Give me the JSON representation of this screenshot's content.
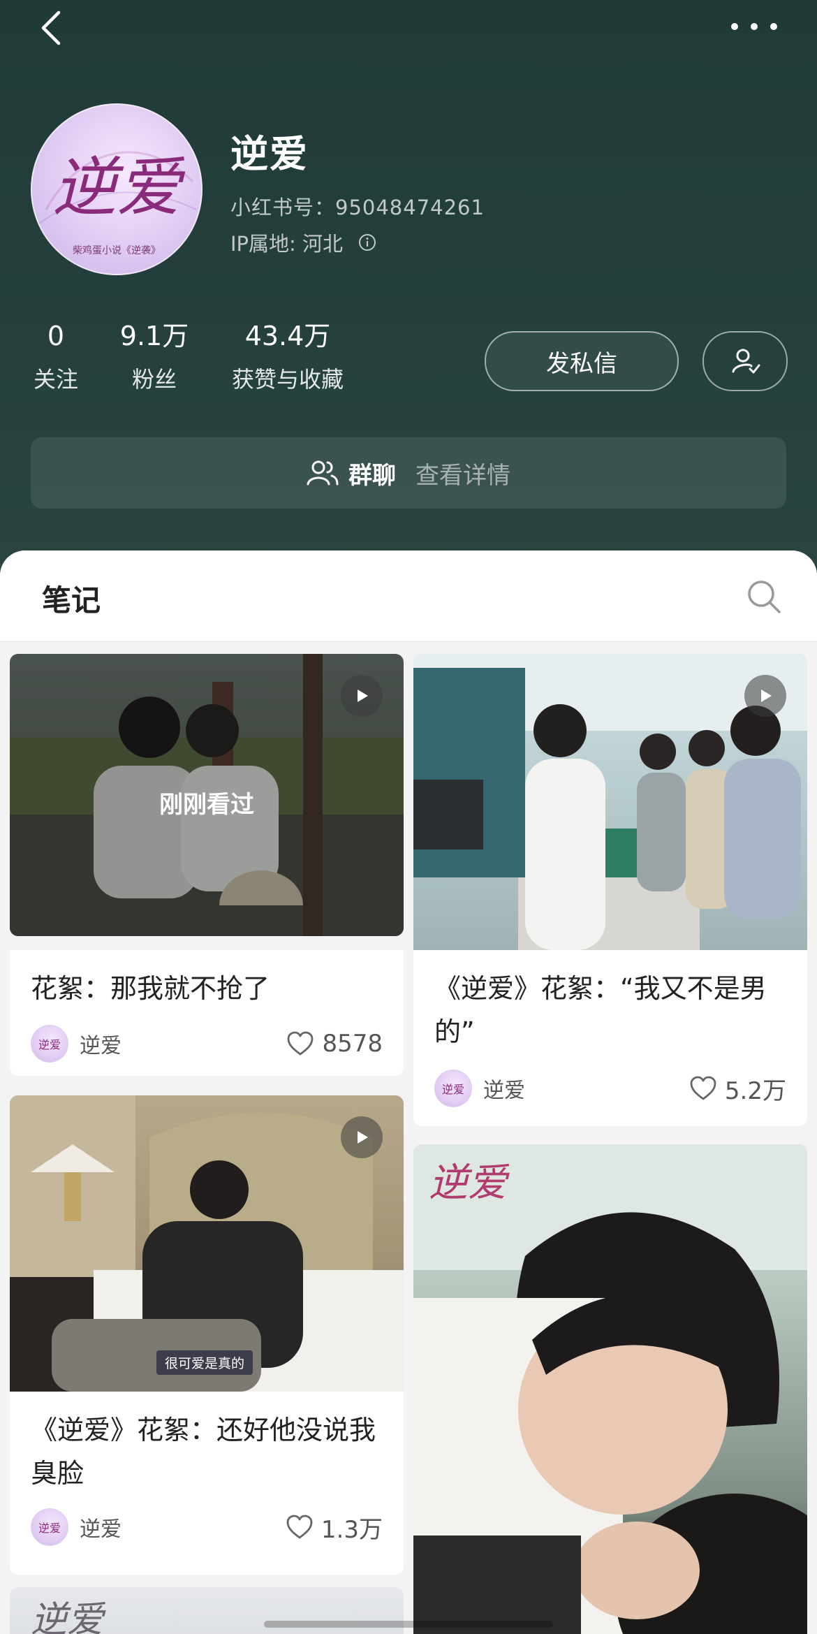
{
  "profile": {
    "name": "逆爱",
    "id_text": "小红书号：95048474261",
    "ip_text": "IP属地: 河北",
    "avatar_text": "逆爱",
    "avatar_caption": "柴鸡蛋小说《逆袭》"
  },
  "stats": [
    {
      "value": "0",
      "label": "关注"
    },
    {
      "value": "9.1万",
      "label": "粉丝"
    },
    {
      "value": "43.4万",
      "label": "获赞与收藏"
    }
  ],
  "actions": {
    "message_label": "发私信"
  },
  "group": {
    "title": "群聊",
    "detail": "查看详情"
  },
  "tabs": {
    "notes": "笔记"
  },
  "notes": [
    {
      "title": "花絮：那我就不抢了",
      "author": "逆爱",
      "likes": "8578",
      "overlay": "刚刚看过",
      "video": true
    },
    {
      "title": "《逆爱》花絮：“我又不是男的”",
      "author": "逆爱",
      "likes": "5.2万",
      "video": true
    },
    {
      "title": "《逆爱》花絮：还好他没说我臭脸",
      "author": "逆爱",
      "likes": "1.3万",
      "video": true,
      "subtitle": "很可爱是真的"
    },
    {
      "image_text": "逆爱"
    },
    {
      "image_text": "逆爱"
    }
  ],
  "colors": {
    "header_bg": "#243f3b",
    "accent_avatar": "#e7d3f6"
  }
}
